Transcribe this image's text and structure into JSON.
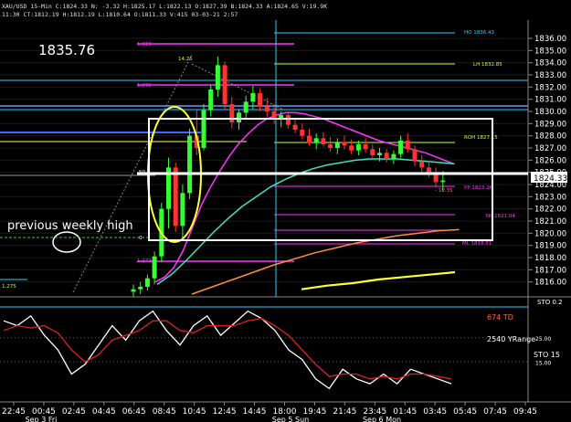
{
  "header": {
    "line1": "XAU/USD 15-Min C:1824.33 N: -3.32 H:1825.17 L:1822.13 O:1827.39 B:1824.33 A:1824.65 V:19.9K",
    "line2": "11:30 CT:1812.19 H:1812.19 L:1810.64 O:1811.33 V:415 03-03-21 2:57"
  },
  "annotations": {
    "big_price": "1835.76",
    "weekly_high": "previous weekly high",
    "level_labels": [
      "HO 1836.43",
      "LH 1832.85",
      "ROH 1827.15",
      "PP 1823.26",
      "NP 1821.04",
      "ML 1818.81",
      "1.618",
      "1.272",
      "1.272",
      "14.25",
      "1.275",
      "- 10.35",
      "50",
      "0"
    ],
    "current_price": "1824.33",
    "td": "674 TD",
    "yrange": "2540 YRange",
    "sto_label": "STO 15",
    "sto_top": "STO 0.2"
  },
  "chart_data": [
    {
      "type": "line",
      "title": "",
      "y_ticks": [
        "1836.00",
        "1835.00",
        "1834.00",
        "1833.00",
        "1832.00",
        "1831.00",
        "1830.00",
        "1829.00",
        "1828.00",
        "1827.00",
        "1826.00",
        "1825.00",
        "1824.00",
        "1823.00",
        "1822.00",
        "1821.00",
        "1820.00",
        "1819.00",
        "1818.00",
        "1817.00",
        "1816.00"
      ],
      "x_ticks": [
        "22:45",
        "00:45",
        "02:45",
        "04:45",
        "06:45",
        "08:45",
        "10:45",
        "12:45",
        "14:45",
        "18:00",
        "19:45",
        "21:45",
        "23:45",
        "01:45",
        "03:45",
        "05:45",
        "07:45",
        "09:45"
      ],
      "session_labels": [
        "Sep 3 Fri",
        "Sep 5 Sun",
        "Sep 6 Mon"
      ],
      "ylim": [
        1815,
        1837.2
      ],
      "candles": [
        {
          "o": 1815.2,
          "h": 1815.8,
          "l": 1814.8,
          "c": 1815.4
        },
        {
          "o": 1815.4,
          "h": 1816.0,
          "l": 1815.0,
          "c": 1815.6
        },
        {
          "o": 1815.6,
          "h": 1816.6,
          "l": 1815.3,
          "c": 1816.3
        },
        {
          "o": 1816.3,
          "h": 1818.5,
          "l": 1815.8,
          "c": 1818.1
        },
        {
          "o": 1818.1,
          "h": 1822.5,
          "l": 1817.6,
          "c": 1822.0
        },
        {
          "o": 1822.0,
          "h": 1826.2,
          "l": 1820.4,
          "c": 1825.4
        },
        {
          "o": 1825.4,
          "h": 1825.8,
          "l": 1820.1,
          "c": 1820.6
        },
        {
          "o": 1820.6,
          "h": 1824.0,
          "l": 1819.4,
          "c": 1823.3
        },
        {
          "o": 1823.3,
          "h": 1828.6,
          "l": 1822.8,
          "c": 1828.0
        },
        {
          "o": 1828.0,
          "h": 1830.1,
          "l": 1826.4,
          "c": 1827.0
        },
        {
          "o": 1827.0,
          "h": 1830.6,
          "l": 1826.8,
          "c": 1830.1
        },
        {
          "o": 1830.1,
          "h": 1832.2,
          "l": 1829.6,
          "c": 1831.8
        },
        {
          "o": 1831.8,
          "h": 1834.5,
          "l": 1831.2,
          "c": 1833.8
        },
        {
          "o": 1833.8,
          "h": 1834.1,
          "l": 1830.2,
          "c": 1830.6
        },
        {
          "o": 1830.6,
          "h": 1831.2,
          "l": 1828.6,
          "c": 1829.1
        },
        {
          "o": 1829.1,
          "h": 1830.2,
          "l": 1828.5,
          "c": 1829.9
        },
        {
          "o": 1829.9,
          "h": 1831.3,
          "l": 1829.4,
          "c": 1830.8
        },
        {
          "o": 1830.8,
          "h": 1832.1,
          "l": 1830.2,
          "c": 1831.5
        },
        {
          "o": 1831.5,
          "h": 1831.9,
          "l": 1830.0,
          "c": 1830.4
        },
        {
          "o": 1830.4,
          "h": 1831.1,
          "l": 1829.5,
          "c": 1830.0
        },
        {
          "o": 1830.0,
          "h": 1830.4,
          "l": 1829.0,
          "c": 1829.4
        },
        {
          "o": 1829.4,
          "h": 1830.0,
          "l": 1828.7,
          "c": 1829.7
        },
        {
          "o": 1829.7,
          "h": 1830.0,
          "l": 1828.6,
          "c": 1828.9
        },
        {
          "o": 1828.9,
          "h": 1829.4,
          "l": 1828.2,
          "c": 1828.5
        },
        {
          "o": 1828.5,
          "h": 1829.0,
          "l": 1827.7,
          "c": 1828.0
        },
        {
          "o": 1828.0,
          "h": 1828.6,
          "l": 1827.2,
          "c": 1827.4
        },
        {
          "o": 1827.4,
          "h": 1828.2,
          "l": 1826.9,
          "c": 1827.8
        },
        {
          "o": 1827.8,
          "h": 1828.3,
          "l": 1827.1,
          "c": 1827.3
        },
        {
          "o": 1827.3,
          "h": 1827.9,
          "l": 1826.7,
          "c": 1827.0
        },
        {
          "o": 1827.0,
          "h": 1827.8,
          "l": 1826.5,
          "c": 1827.5
        },
        {
          "o": 1827.5,
          "h": 1828.0,
          "l": 1826.9,
          "c": 1827.2
        },
        {
          "o": 1827.2,
          "h": 1827.7,
          "l": 1826.5,
          "c": 1826.8
        },
        {
          "o": 1826.8,
          "h": 1827.6,
          "l": 1826.4,
          "c": 1827.3
        },
        {
          "o": 1827.3,
          "h": 1827.8,
          "l": 1826.6,
          "c": 1826.9
        },
        {
          "o": 1826.9,
          "h": 1827.3,
          "l": 1826.1,
          "c": 1826.4
        },
        {
          "o": 1826.4,
          "h": 1827.0,
          "l": 1825.9,
          "c": 1826.6
        },
        {
          "o": 1826.6,
          "h": 1826.9,
          "l": 1825.8,
          "c": 1826.1
        },
        {
          "o": 1826.1,
          "h": 1826.8,
          "l": 1825.7,
          "c": 1826.5
        },
        {
          "o": 1826.5,
          "h": 1828.0,
          "l": 1826.2,
          "c": 1827.6
        },
        {
          "o": 1827.6,
          "h": 1828.2,
          "l": 1826.6,
          "c": 1826.9
        },
        {
          "o": 1826.9,
          "h": 1827.2,
          "l": 1825.5,
          "c": 1825.9
        },
        {
          "o": 1825.9,
          "h": 1826.4,
          "l": 1825.0,
          "c": 1825.4
        },
        {
          "o": 1825.4,
          "h": 1825.9,
          "l": 1824.6,
          "c": 1825.0
        },
        {
          "o": 1825.0,
          "h": 1825.4,
          "l": 1823.8,
          "c": 1824.2
        },
        {
          "o": 1824.2,
          "h": 1825.1,
          "l": 1823.5,
          "c": 1824.33
        }
      ],
      "moving_averages": [
        {
          "name": "",
          "color": "#ff33ff",
          "values": [
            1816.0,
            1816.4,
            1817.2,
            1818.6,
            1820.5,
            1822.4,
            1823.9,
            1825.2,
            1826.4,
            1827.4,
            1828.2,
            1828.9,
            1829.4,
            1829.7,
            1829.9,
            1829.9,
            1829.8,
            1829.6,
            1829.4,
            1829.1,
            1828.8,
            1828.5,
            1828.2,
            1827.9,
            1827.6,
            1827.4,
            1827.2,
            1827.0,
            1826.8,
            1826.6,
            1826.3,
            1826.0,
            1825.7
          ]
        },
        {
          "name": "",
          "color": "#40e0c0",
          "values": [
            1815.8,
            1816.6,
            1817.7,
            1818.9,
            1820.1,
            1821.2,
            1822.2,
            1823.0,
            1823.8,
            1824.4,
            1824.9,
            1825.3,
            1825.6,
            1825.8,
            1826.0,
            1826.1,
            1826.1,
            1826.1,
            1826.0,
            1825.9,
            1825.8,
            1825.7
          ]
        },
        {
          "name": "",
          "color": "#ff8c40",
          "values": [
            1815.0,
            1815.6,
            1816.2,
            1816.8,
            1817.4,
            1817.9,
            1818.4,
            1818.8,
            1819.2,
            1819.5,
            1819.8,
            1820.0,
            1820.2,
            1820.3
          ]
        },
        {
          "name": "",
          "color": "#ffff33",
          "values": [
            1815.4,
            1815.7,
            1815.9,
            1816.2,
            1816.4,
            1816.6,
            1816.8
          ]
        }
      ]
    },
    {
      "type": "line",
      "title": "",
      "y_ticks": [
        "25.00",
        "15.00"
      ],
      "ylim": [
        0,
        40
      ],
      "series": [
        {
          "name": "",
          "color": "#ffffff",
          "values": [
            32,
            30,
            34,
            26,
            20,
            10,
            14,
            22,
            30,
            24,
            32,
            36,
            28,
            22,
            30,
            34,
            26,
            31,
            36,
            33,
            28,
            20,
            16,
            8,
            4,
            12,
            8,
            6,
            10,
            6,
            12,
            10,
            8,
            6
          ]
        },
        {
          "name": "",
          "color": "#e02020",
          "values": [
            28,
            30,
            29,
            30,
            27,
            20,
            15,
            18,
            24,
            26,
            28,
            32,
            32,
            28,
            27,
            30,
            30,
            30,
            32,
            33,
            30,
            26,
            20,
            14,
            9,
            10,
            10,
            8,
            9,
            8,
            10,
            10,
            9,
            8
          ]
        }
      ]
    }
  ]
}
